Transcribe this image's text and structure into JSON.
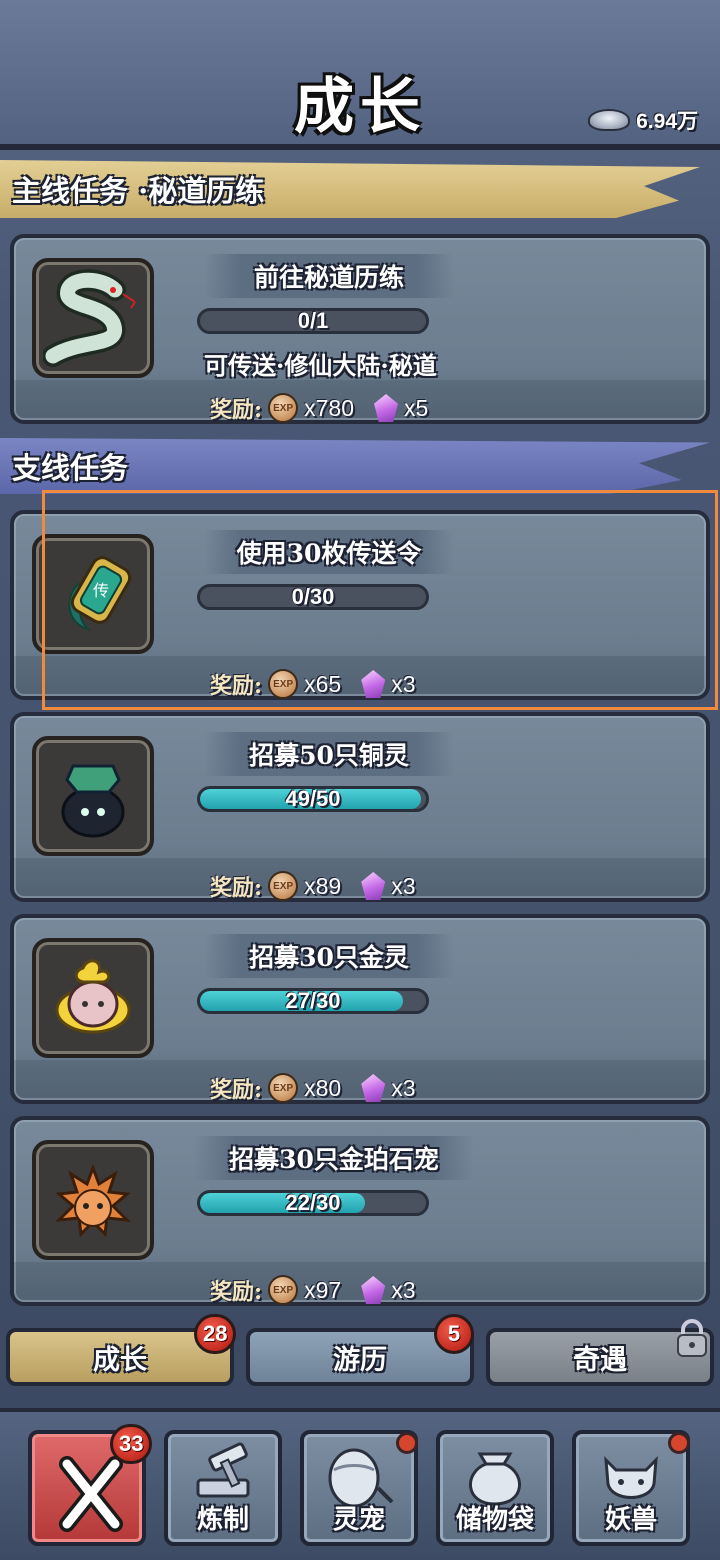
{
  "header": {
    "title": "成长",
    "currency_value": "6.94万"
  },
  "main_quest": {
    "banner": "主线任务 ·秘道历练",
    "task": {
      "name": "前往秘道历练",
      "progress_text": "0/1",
      "progress": 0.0,
      "location": "可传送·修仙大陆·秘道",
      "reward_label": "奖励:",
      "exp_icon": "EXP",
      "exp_amount": "x780",
      "gem_amount": "x5"
    }
  },
  "side_quests": {
    "banner": "支线任务",
    "tasks": [
      {
        "name": "使用30枚传送令",
        "progress_text": "0/30",
        "progress": 0.0,
        "reward_label": "奖励:",
        "exp_icon": "EXP",
        "exp_amount": "x65",
        "gem_amount": "x3"
      },
      {
        "name": "招募50只铜灵",
        "progress_text": "49/50",
        "progress": 0.98,
        "reward_label": "奖励:",
        "exp_icon": "EXP",
        "exp_amount": "x89",
        "gem_amount": "x3"
      },
      {
        "name": "招募30只金灵",
        "progress_text": "27/30",
        "progress": 0.9,
        "reward_label": "奖励:",
        "exp_icon": "EXP",
        "exp_amount": "x80",
        "gem_amount": "x3"
      },
      {
        "name": "招募30只金珀石宠",
        "progress_text": "22/30",
        "progress": 0.73,
        "reward_label": "奖励:",
        "exp_icon": "EXP",
        "exp_amount": "x97",
        "gem_amount": "x3"
      }
    ]
  },
  "tabs": [
    {
      "label": "成长",
      "badge": "28",
      "state": "active"
    },
    {
      "label": "游历",
      "badge": "5",
      "state": "normal"
    },
    {
      "label": "奇遇",
      "badge": "",
      "state": "locked"
    }
  ],
  "bottom_nav": {
    "close_badge": "33",
    "items": [
      {
        "label": "炼制",
        "icon": "hammer-anvil-icon",
        "dot": false
      },
      {
        "label": "灵宠",
        "icon": "pet-egg-icon",
        "dot": true
      },
      {
        "label": "储物袋",
        "icon": "storage-bag-icon",
        "dot": false
      },
      {
        "label": "妖兽",
        "icon": "demon-beast-icon",
        "dot": true
      }
    ]
  },
  "colors": {
    "highlight": "#f08a3c",
    "progress_fill": "#2fbac4",
    "badge": "#c42c20"
  }
}
